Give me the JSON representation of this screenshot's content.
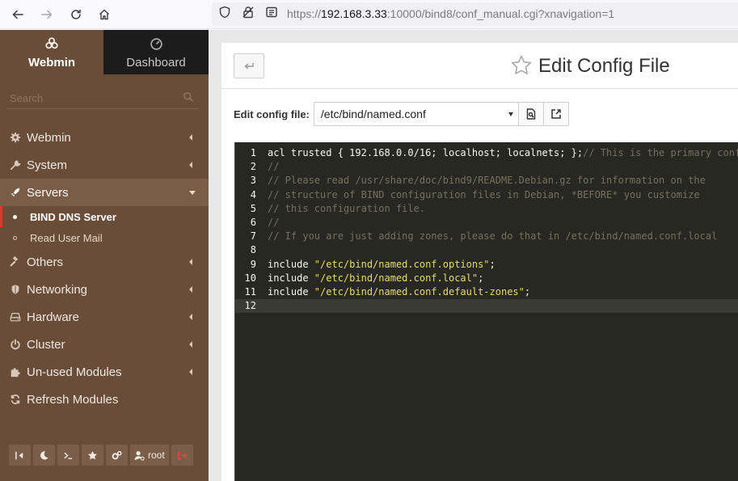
{
  "browser": {
    "url_prefix": "https://",
    "url_host": "192.168.3.33",
    "url_rest": ":10000/bind8/conf_manual.cgi?xnavigation=1"
  },
  "sidebar": {
    "tabs": [
      {
        "label": "Webmin",
        "icon": "webmin-logo-icon"
      },
      {
        "label": "Dashboard",
        "icon": "dashboard-gauge-icon"
      }
    ],
    "search_placeholder": "Search",
    "items": [
      {
        "label": "Webmin",
        "icon": "gear-icon"
      },
      {
        "label": "System",
        "icon": "wrench-icon"
      },
      {
        "label": "Servers",
        "icon": "rocket-icon"
      },
      {
        "label": "Others",
        "icon": "gavel-icon"
      },
      {
        "label": "Networking",
        "icon": "shield-icon"
      },
      {
        "label": "Hardware",
        "icon": "hdd-icon"
      },
      {
        "label": "Cluster",
        "icon": "power-icon"
      },
      {
        "label": "Un-used Modules",
        "icon": "puzzle-icon"
      },
      {
        "label": "Refresh Modules",
        "icon": "refresh-icon"
      }
    ],
    "sub_items": [
      {
        "label": "BIND DNS Server"
      },
      {
        "label": "Read User Mail"
      }
    ],
    "bottom_buttons": {
      "user_label": "root"
    }
  },
  "main": {
    "title": "Edit Config File",
    "file_label": "Edit config file:",
    "file_value": "/etc/bind/named.conf"
  },
  "editor": {
    "lines": [
      {
        "n": "1",
        "segments": [
          {
            "t": "acl trusted { 192.168.0.0/16; localhost; localnets; };",
            "c": "plain"
          },
          {
            "t": "// This is the primary conf",
            "c": "comment"
          }
        ]
      },
      {
        "n": "2",
        "segments": [
          {
            "t": "//",
            "c": "comment"
          }
        ]
      },
      {
        "n": "3",
        "segments": [
          {
            "t": "// Please read /usr/share/doc/bind9/README.Debian.gz for information on the",
            "c": "comment"
          }
        ]
      },
      {
        "n": "4",
        "segments": [
          {
            "t": "// structure of BIND configuration files in Debian, *BEFORE* you customize",
            "c": "comment"
          }
        ]
      },
      {
        "n": "5",
        "segments": [
          {
            "t": "// this configuration file.",
            "c": "comment"
          }
        ]
      },
      {
        "n": "6",
        "segments": [
          {
            "t": "//",
            "c": "comment"
          }
        ]
      },
      {
        "n": "7",
        "segments": [
          {
            "t": "// If you are just adding zones, please do that in /etc/bind/named.conf.local",
            "c": "comment"
          }
        ]
      },
      {
        "n": "8",
        "segments": []
      },
      {
        "n": "9",
        "segments": [
          {
            "t": "include ",
            "c": "plain"
          },
          {
            "t": "\"/etc/bind/named.conf.options\"",
            "c": "string"
          },
          {
            "t": ";",
            "c": "plain"
          }
        ]
      },
      {
        "n": "10",
        "segments": [
          {
            "t": "include ",
            "c": "plain"
          },
          {
            "t": "\"/etc/bind/named.conf.local\"",
            "c": "string"
          },
          {
            "t": ";",
            "c": "plain"
          }
        ]
      },
      {
        "n": "11",
        "segments": [
          {
            "t": "include ",
            "c": "plain"
          },
          {
            "t": "\"/etc/bind/named.conf.default-zones\"",
            "c": "string"
          },
          {
            "t": ";",
            "c": "plain"
          }
        ]
      },
      {
        "n": "12",
        "segments": []
      }
    ]
  }
}
